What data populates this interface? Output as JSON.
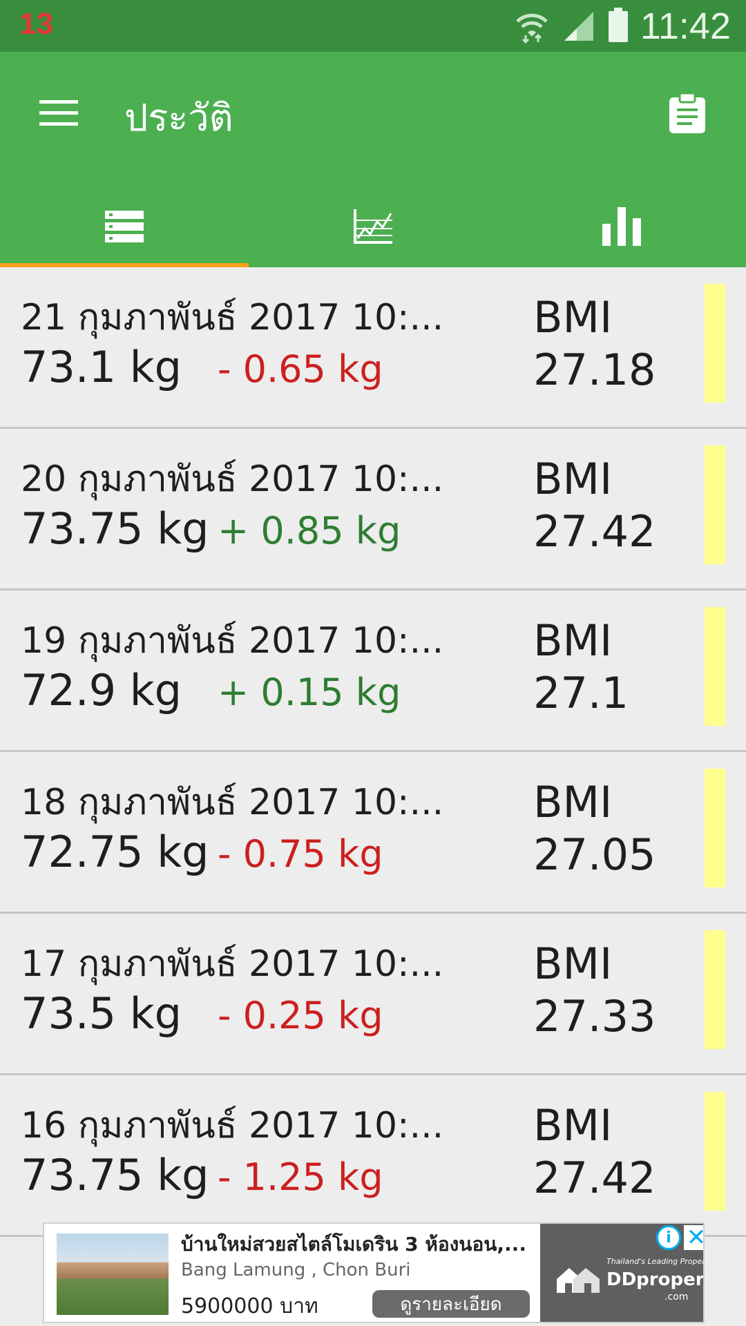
{
  "status_bar": {
    "notification_count": "13",
    "time": "11:42",
    "icons": [
      "wifi-icon",
      "signal-icon",
      "battery-icon"
    ]
  },
  "app_bar": {
    "title": "ประวัติ",
    "menu_icon": "menu-icon",
    "action_icon": "clipboard-icon",
    "background": "#4caf50",
    "tab_indicator_color": "#f4a21b"
  },
  "tabs": [
    {
      "icon": "list-icon",
      "active": true
    },
    {
      "icon": "line-chart-icon",
      "active": false
    },
    {
      "icon": "bar-chart-icon",
      "active": false
    }
  ],
  "entries": [
    {
      "date": "21 กุมภาพันธ์ 2017 10:...",
      "weight": "73.1 kg",
      "diff": "- 0.65 kg",
      "diff_dir": "down",
      "bmi_label": "BMI",
      "bmi": "27.18"
    },
    {
      "date": "20 กุมภาพันธ์ 2017 10:...",
      "weight": "73.75 kg",
      "diff": "+ 0.85 kg",
      "diff_dir": "up",
      "bmi_label": "BMI",
      "bmi": "27.42"
    },
    {
      "date": "19 กุมภาพันธ์ 2017 10:...",
      "weight": "72.9 kg",
      "diff": "+ 0.15 kg",
      "diff_dir": "up",
      "bmi_label": "BMI",
      "bmi": "27.1"
    },
    {
      "date": "18 กุมภาพันธ์ 2017 10:...",
      "weight": "72.75 kg",
      "diff": "- 0.75 kg",
      "diff_dir": "down",
      "bmi_label": "BMI",
      "bmi": "27.05"
    },
    {
      "date": "17 กุมภาพันธ์ 2017 10:...",
      "weight": "73.5 kg",
      "diff": "- 0.25 kg",
      "diff_dir": "down",
      "bmi_label": "BMI",
      "bmi": "27.33"
    },
    {
      "date": "16 กุมภาพันธ์ 2017 10:...",
      "weight": "73.75 kg",
      "diff": "- 1.25 kg",
      "diff_dir": "down",
      "bmi_label": "BMI",
      "bmi": "27.42"
    }
  ],
  "colors": {
    "diff_down": "#cc1f1f",
    "diff_up": "#2e7d32",
    "bmi_indicator": "#ffff8d"
  },
  "ad": {
    "title": "บ้านใหม่สวยสไตล์โมเดริน 3 ห้องนอน,...",
    "location": "Bang Lamung , Chon Buri",
    "price": "5900000 บาท",
    "cta": "ดูรายละเอียด",
    "brand_tagline": "Thailand's Leading Property Site",
    "brand_name": "DDproperty",
    "brand_domain": ".com",
    "info_label": "i",
    "close_label": "✕"
  }
}
